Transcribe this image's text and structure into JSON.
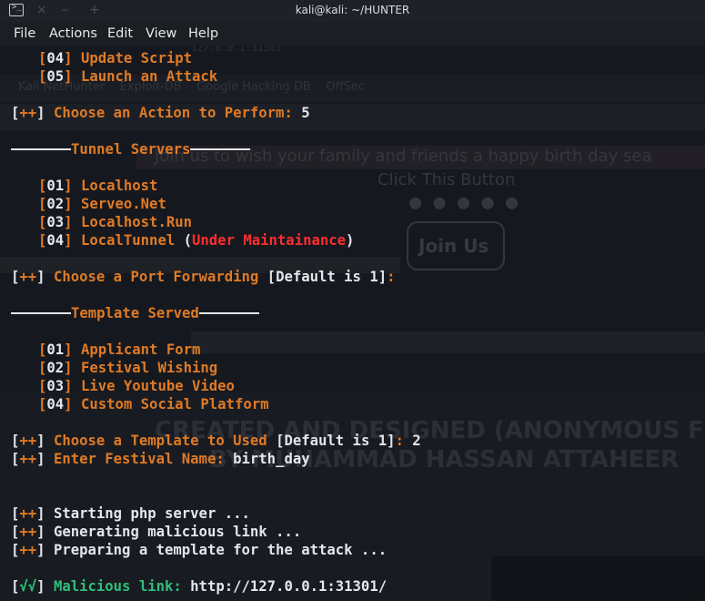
{
  "window": {
    "title": "kali@kali: ~/HUNTER"
  },
  "menu": [
    "File",
    "Actions",
    "Edit",
    "View",
    "Help"
  ],
  "background_page": {
    "tabs": [
      "Exploit-DB",
      "Google Hacking DB",
      "OffSec"
    ],
    "nav_partial": "Kali NetHunter",
    "banner": "Join us to wish your family and friends a happy birth day sea",
    "click_button": "Click This Button",
    "join_button": "Join Us",
    "heading1": "CREATED AND DESIGNED (ANONYMOUS FR",
    "heading2": "BY MUHAMMAD HASSAN ATTAHEER",
    "address_fragment": "127.0.0.1:31301"
  },
  "terminal": {
    "menu_items": [
      {
        "num": "04",
        "label": "Update Script"
      },
      {
        "num": "05",
        "label": "Launch an Attack"
      }
    ],
    "prompt_action": {
      "tag": "++",
      "text": "Choose an Action to Perform:",
      "value": "5"
    },
    "tunnel_header": "Tunnel Servers",
    "tunnels": [
      {
        "num": "01",
        "label": "Localhost"
      },
      {
        "num": "02",
        "label": "Serveo.Net"
      },
      {
        "num": "03",
        "label": "Localhost.Run"
      },
      {
        "num": "04",
        "label": "LocalTunnel",
        "note": "Under Maintainance"
      }
    ],
    "prompt_port": {
      "tag": "++",
      "text": "Choose a Port Forwarding",
      "default": "Default is 1"
    },
    "template_header": "Template Served",
    "templates": [
      {
        "num": "01",
        "label": "Applicant Form"
      },
      {
        "num": "02",
        "label": "Festival Wishing"
      },
      {
        "num": "03",
        "label": "Live Youtube Video"
      },
      {
        "num": "04",
        "label": "Custom Social Platform"
      }
    ],
    "prompt_template": {
      "tag": "++",
      "text": "Choose a Template to Used",
      "default": "Default is 1",
      "value": "2"
    },
    "prompt_festival": {
      "tag": "++",
      "text": "Enter Festival Name:",
      "value": "birth_day"
    },
    "status": [
      {
        "tag": "++",
        "text": "Starting php server ..."
      },
      {
        "tag": "++",
        "text": "Generating malicious link ..."
      },
      {
        "tag": "++",
        "text": "Preparing a template for the attack ..."
      }
    ],
    "result": {
      "tag": "√√",
      "label": "Malicious link:",
      "url": "http://127.0.0.1:31301/"
    }
  },
  "colors": {
    "orange": "#e07a25",
    "white": "#e4e6ea",
    "green": "#2fbf7a",
    "red": "#ff2d2d",
    "background": "#15191f"
  }
}
